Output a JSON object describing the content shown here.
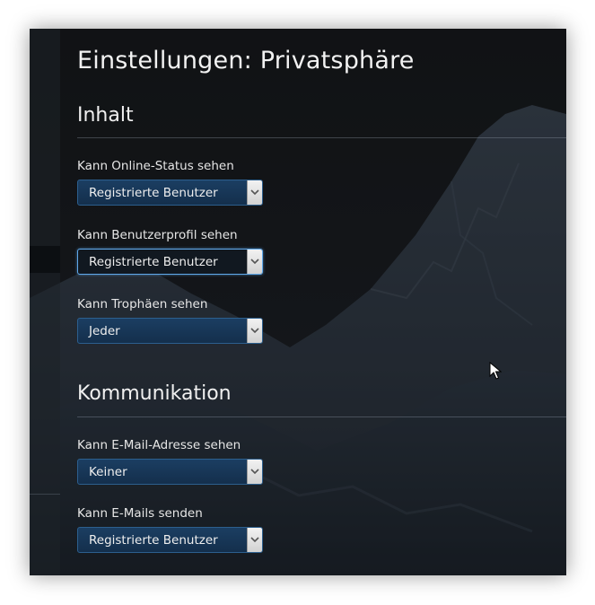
{
  "page": {
    "title": "Einstellungen: Privatsphäre"
  },
  "sections": [
    {
      "heading": "Inhalt",
      "fields": [
        {
          "label": "Kann Online-Status sehen",
          "value": "Registrierte Benutzer"
        },
        {
          "label": "Kann Benutzerprofil sehen",
          "value": "Registrierte Benutzer"
        },
        {
          "label": "Kann Trophäen sehen",
          "value": "Jeder"
        }
      ]
    },
    {
      "heading": "Kommunikation",
      "fields": [
        {
          "label": "Kann E-Mail-Adresse sehen",
          "value": "Keiner"
        },
        {
          "label": "Kann E-Mails senden",
          "value": "Registrierte Benutzer"
        }
      ]
    }
  ],
  "icons": {
    "dropdown": "chevron-down-icon",
    "cursor": "mouse-pointer-icon"
  },
  "colors": {
    "select_background": "#1b3e62",
    "select_border": "#2c5f8e",
    "focused_border": "#5fa8ea",
    "text": "#f2f2f2"
  }
}
